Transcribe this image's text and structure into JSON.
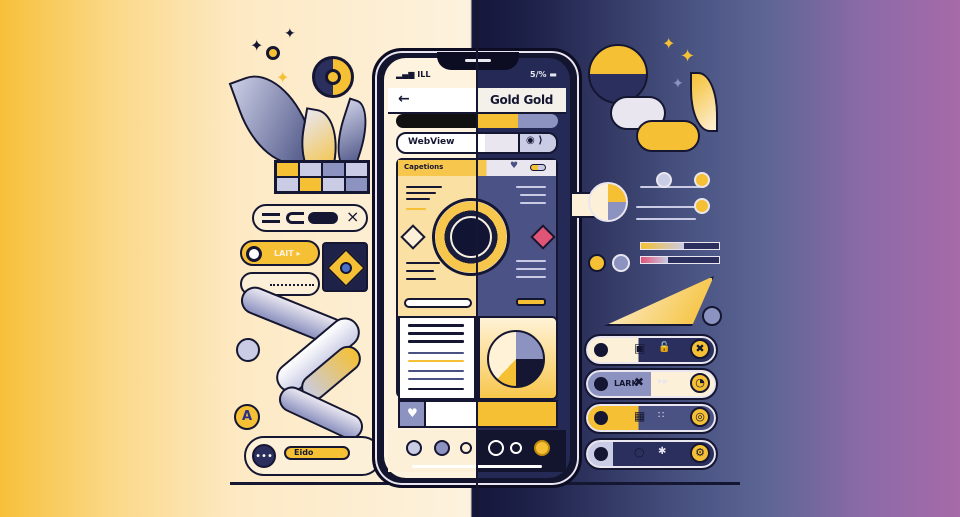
{
  "theme": {
    "light_bg": "#fdf2de",
    "dark_bg": "#14163a",
    "accent_gold": "#f5c033",
    "accent_periwinkle": "#8d93c0",
    "edge_left": "#f7c03a",
    "edge_right": "#a66aa8",
    "ink": "#151632"
  },
  "phone": {
    "status_left": "▂▄▆ ILL",
    "status_right": "5/% ▬",
    "header": {
      "back_icon": "←",
      "title": "Gold Gold"
    },
    "address_bar": {
      "value": "WebView",
      "action_icon": "◉ ⟩"
    },
    "card": {
      "header_label": "Capetions",
      "header_icons": [
        "♥",
        "▭"
      ]
    },
    "tab_icons": [
      "spiral-icon",
      "spiral-icon",
      "swirl-icon",
      "ring-icon",
      "refresh-icon",
      "gold-spiral-icon"
    ]
  },
  "left_panel": {
    "toolbar_close": "×",
    "play_pill_label": "LAIT ▸",
    "chat_pill_label": "Eido",
    "chat_icon": "•••",
    "a_badge": "A"
  },
  "right_panel": {
    "rows": [
      {
        "label": "",
        "mid_icon": "▣",
        "lock_icon": "🔓",
        "end_icon": "✖"
      },
      {
        "label": "LARK",
        "mid_icon": "✖",
        "lock_icon": "▸▸",
        "end_icon": "◔"
      },
      {
        "label": "",
        "mid_icon": "▦",
        "lock_icon": "∷",
        "end_icon": "◎"
      },
      {
        "label": "",
        "mid_icon": "○",
        "lock_icon": "✱",
        "end_icon": "⚙"
      }
    ],
    "progress": [
      {
        "name": "gold",
        "value": 0.55
      },
      {
        "name": "pink",
        "value": 0.35
      }
    ]
  }
}
